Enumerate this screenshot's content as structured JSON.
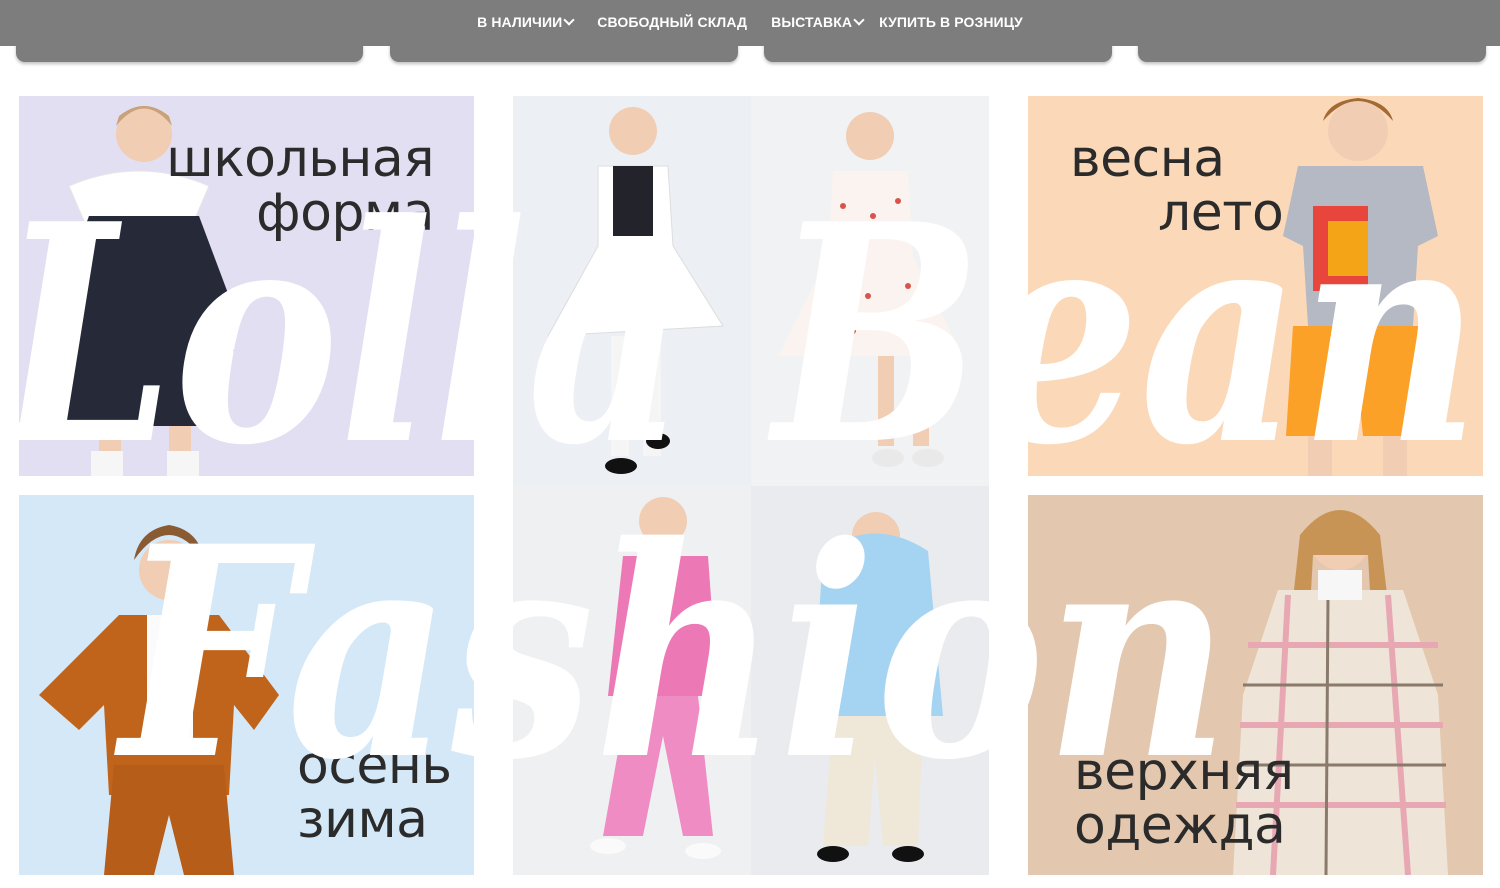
{
  "nav": {
    "items": [
      {
        "label": "В НАЛИЧИИ",
        "has_dropdown": true
      },
      {
        "label": "СВОБОДНЫЙ СКЛАД",
        "has_dropdown": false
      },
      {
        "label": "ВЫСТАВКА",
        "has_dropdown": true
      },
      {
        "label": "КУПИТЬ В РОЗНИЦУ",
        "has_dropdown": false
      }
    ]
  },
  "categories": [
    {
      "lines": [
        "школьная",
        "форма"
      ],
      "bg": "#e3dff2"
    },
    {
      "lines": [
        "весна",
        "лето"
      ],
      "bg": "#fbd9b8"
    },
    {
      "lines": [
        "осень",
        "зима"
      ],
      "bg": "#d4e8f7"
    },
    {
      "lines": [
        "верхняя",
        "одежда"
      ],
      "bg": "#e3c7ae"
    }
  ],
  "watermark": {
    "line1": "Lolla Bean",
    "line2": "Fashion"
  },
  "colors": {
    "topbar": "#7d7d7d",
    "text": "#2b2b2b"
  }
}
